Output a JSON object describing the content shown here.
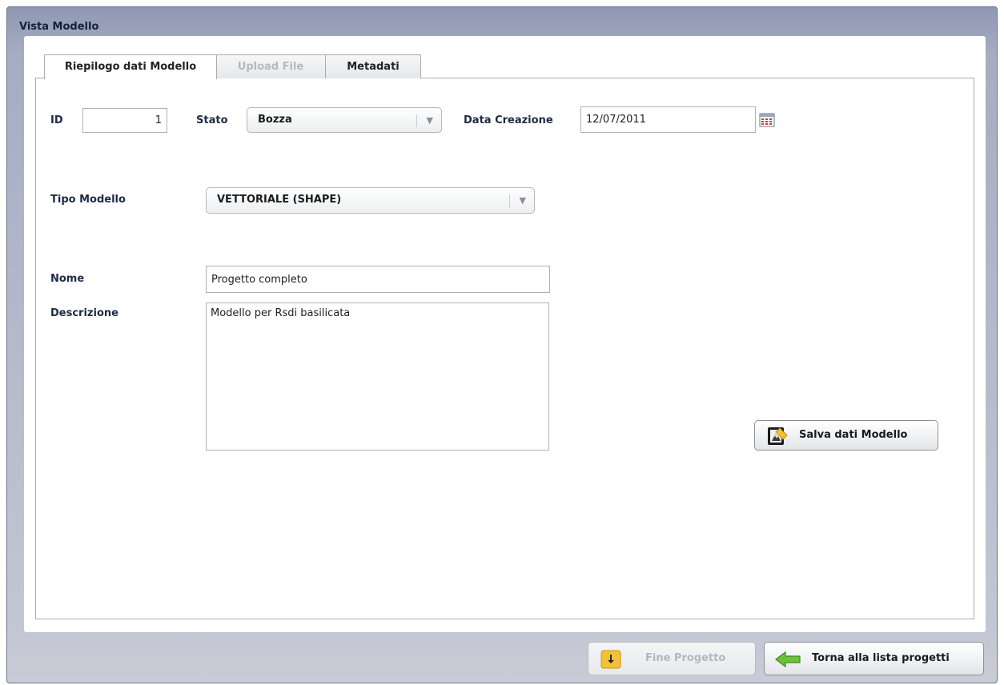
{
  "window": {
    "title": "Vista Modello"
  },
  "tabs": [
    {
      "label": "Riepilogo dati Modello",
      "state": "active"
    },
    {
      "label": "Upload File",
      "state": "disabled"
    },
    {
      "label": "Metadati",
      "state": "normal"
    }
  ],
  "form": {
    "id_label": "ID",
    "id_value": "1",
    "stato_label": "Stato",
    "stato_value": "Bozza",
    "data_label": "Data Creazione",
    "data_value": "12/07/2011",
    "tipo_label": "Tipo Modello",
    "tipo_value": "VETTORIALE (SHAPE)",
    "nome_label": "Nome",
    "nome_value": "Progetto completo",
    "descrizione_label": "Descrizione",
    "descrizione_value": "Modello per Rsdi basilicata"
  },
  "buttons": {
    "salva": "Salva dati Modello",
    "fine": "Fine Progetto",
    "torna": "Torna alla lista progetti"
  },
  "icons": {
    "calendar": "calendar-icon",
    "dropdown": "chevron-down-icon",
    "save": "save-edit-icon",
    "finish": "download-arrow-icon",
    "back": "back-arrow-icon"
  },
  "colors": {
    "header": "#8f97b3",
    "title_text": "#14213d",
    "back_arrow": "#6cc33a",
    "finish_icon": "#f2c232"
  }
}
